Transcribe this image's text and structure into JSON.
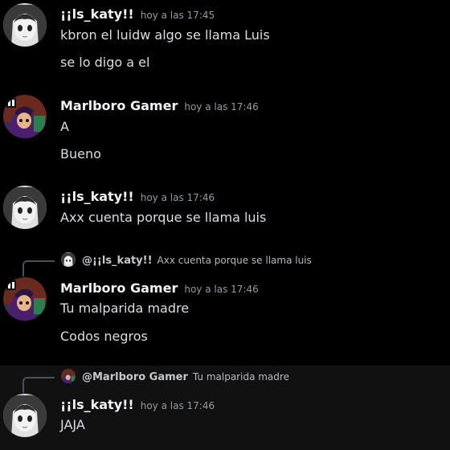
{
  "messages": [
    {
      "author": "¡¡ls_katy!!",
      "timestamp": "hoy a las 17:45",
      "lines": [
        "kbron el luidw algo se llama Luis",
        "se lo digo a el"
      ]
    },
    {
      "author": "Marlboro Gamer",
      "timestamp": "hoy a las 17:46",
      "lines": [
        "A",
        "Bueno"
      ]
    },
    {
      "author": "¡¡ls_katy!!",
      "timestamp": "hoy a las 17:46",
      "lines": [
        "Axx cuenta porque se llama luis"
      ]
    },
    {
      "reply": {
        "author": "@¡¡ls_katy!!",
        "content": "Axx cuenta porque se llama luis"
      },
      "author": "Marlboro Gamer",
      "timestamp": "hoy a las 17:46",
      "lines": [
        "Tu malparida madre",
        "Codos negros"
      ]
    },
    {
      "reply": {
        "author": "@Marlboro Gamer",
        "content": "Tu malparida madre"
      },
      "author": "¡¡ls_katy!!",
      "timestamp": "hoy a las 17:46",
      "lines": [
        "JAJA"
      ]
    }
  ],
  "colors": {
    "background": "#000000",
    "highlight_background": "#121111",
    "author": "#f2f3f5",
    "timestamp": "#949ba4",
    "message_text": "#dbdee1"
  },
  "icons": {
    "katy_avatar": "anime-girl-grayscale-avatar",
    "marlboro_avatar": "cartoon-network-character-avatar"
  }
}
